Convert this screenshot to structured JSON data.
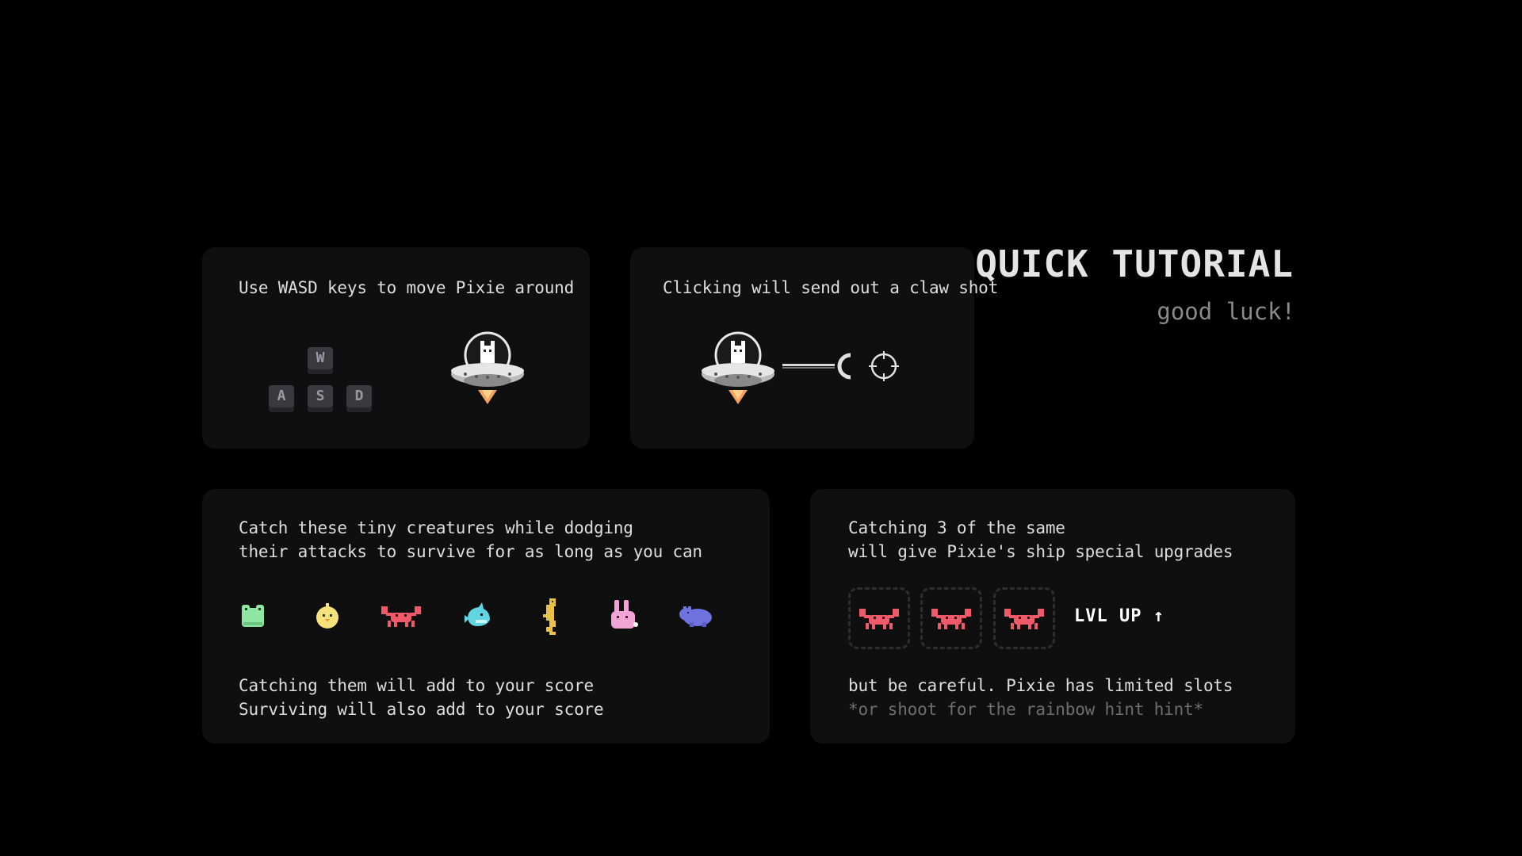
{
  "header": {
    "title": "QUICK TUTORIAL",
    "subtitle": "good luck!"
  },
  "cards": {
    "move": {
      "text": "Use WASD keys to move Pixie around",
      "keys": [
        "W",
        "A",
        "S",
        "D"
      ]
    },
    "shoot": {
      "text": "Clicking will send out a claw shot"
    },
    "creatures": {
      "line1": "Catch these tiny creatures while dodging",
      "line2": "their attacks to survive for as long as you can",
      "line3": "Catching them will add to your score",
      "line4": "Surviving will also add to your score",
      "creature_icons": [
        "frog-icon",
        "chick-icon",
        "crab-icon",
        "shark-icon",
        "seahorse-icon",
        "bunny-icon",
        "hippo-icon"
      ],
      "creature_colors": [
        "#8ee6a0",
        "#f6e27a",
        "#ef5a6a",
        "#5fd6e0",
        "#e8c14a",
        "#f2a4d6",
        "#6f73e0"
      ]
    },
    "upgrades": {
      "line1": "Catching 3 of the same",
      "line2": "will give Pixie's ship special upgrades",
      "lvl_up": "LVL UP ↑",
      "line3": "but be careful. Pixie has limited slots",
      "hint": "*or shoot for the rainbow hint hint*"
    }
  },
  "colors": {
    "background": "#000000",
    "card": "#0f0f0f",
    "text": "#dedede",
    "muted": "#6e6e6e",
    "crab": "#ef5a6a",
    "flame": "#f5a25d"
  }
}
